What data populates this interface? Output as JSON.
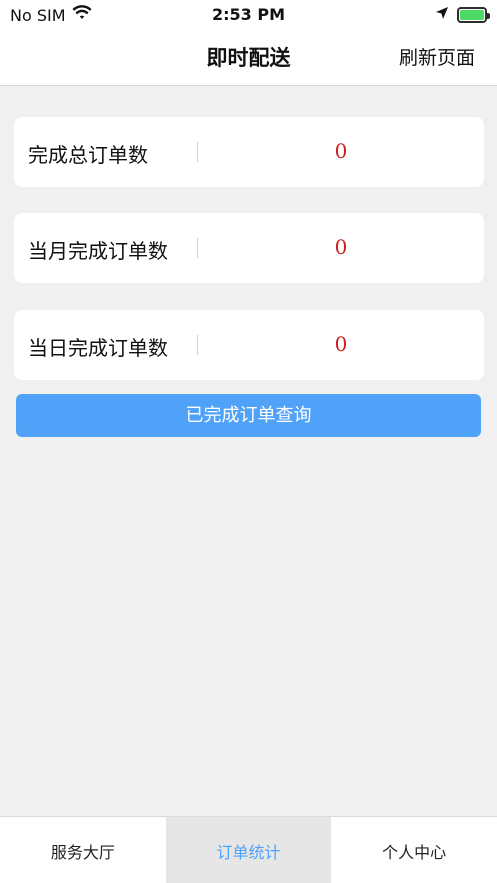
{
  "status_bar": {
    "carrier": "No SIM",
    "time": "2:53 PM",
    "icons": [
      "wifi-icon",
      "location-arrow-icon",
      "battery-charging-icon"
    ]
  },
  "nav": {
    "title": "即时配送",
    "right_button": "刷新页面"
  },
  "stats": [
    {
      "label": "完成总订单数",
      "value": "0"
    },
    {
      "label": "当月完成订单数",
      "value": "0"
    },
    {
      "label": "当日完成订单数",
      "value": "0"
    }
  ],
  "query_button": "已完成订单查询",
  "tabs": [
    {
      "label": "服务大厅",
      "active": false
    },
    {
      "label": "订单统计",
      "active": true
    },
    {
      "label": "个人中心",
      "active": false
    }
  ],
  "colors": {
    "accent": "#4fa2f7",
    "value_red": "#cc1f1f",
    "background": "#f0f0f0"
  }
}
